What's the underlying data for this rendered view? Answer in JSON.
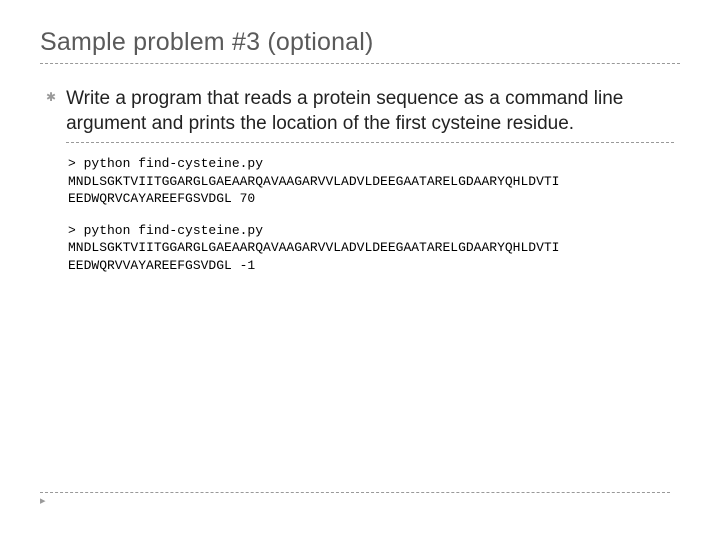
{
  "title": "Sample problem #3 (optional)",
  "bullet": {
    "icon": "✱",
    "text": "Write a program that reads a protein sequence as a command line argument and prints the location of the first cysteine residue."
  },
  "code": {
    "block1": {
      "line1": "> python find-cysteine.py",
      "line2": "MNDLSGKTVIITGGARGLGAEAARQAVAAGARVVLADVLDEEGAATARELGDAARYQHLDVTI",
      "line3": "EEDWQRVCAYAREEFGSVDGL 70"
    },
    "block2": {
      "line1": "> python find-cysteine.py",
      "line2": "MNDLSGKTVIITGGARGLGAEAARQAVAAGARVVLADVLDEEGAATARELGDAARYQHLDVTI",
      "line3": "EEDWQRVVAYAREEFGSVDGL -1"
    }
  },
  "footerTri": "▸"
}
